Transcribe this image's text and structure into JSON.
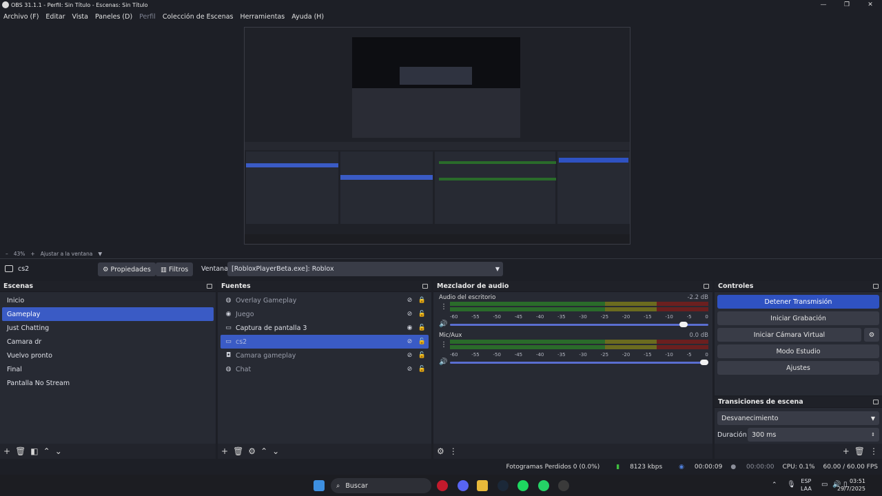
{
  "window": {
    "title": "OBS 31.1.1 - Perfil: Sin Título - Escenas: Sin Título"
  },
  "menu": [
    "Archivo (F)",
    "Editar",
    "Vista",
    "Paneles (D)",
    "Perfil",
    "Colección de Escenas",
    "Herramientas",
    "Ayuda (H)"
  ],
  "zoom": {
    "minus": "–",
    "level": "43%",
    "plus": "+",
    "fit": "Ajustar a la ventana"
  },
  "context": {
    "current": "cs2",
    "properties": "Propiedades",
    "filters": "Filtros",
    "window_label": "Ventana",
    "window_value": "[RobloxPlayerBeta.exe]: Roblox"
  },
  "scenes": {
    "title": "Escenas",
    "items": [
      "Inicio",
      "Gameplay",
      "Just Chatting",
      "Camara dr",
      "Vuelvo pronto",
      "Final",
      "Pantalla No Stream"
    ],
    "active_index": 1
  },
  "sources": {
    "title": "Fuentes",
    "items": [
      {
        "name": "Overlay Gameplay",
        "icon": "globe-icon",
        "visible": false,
        "locked": true
      },
      {
        "name": "Juego",
        "icon": "gamepad-icon",
        "visible": false,
        "locked": false
      },
      {
        "name": "Captura de pantalla 3",
        "icon": "monitor-icon",
        "visible": true,
        "locked": false
      },
      {
        "name": "cs2",
        "icon": "window-icon",
        "visible": false,
        "locked": false
      },
      {
        "name": "Camara gameplay",
        "icon": "camera-icon",
        "visible": false,
        "locked": false
      },
      {
        "name": "Chat",
        "icon": "globe-icon",
        "visible": false,
        "locked": false
      }
    ],
    "active_index": 3
  },
  "mixer": {
    "title": "Mezclador de audio",
    "ticks": [
      "-60",
      "-55",
      "-50",
      "-45",
      "-40",
      "-35",
      "-30",
      "-25",
      "-20",
      "-15",
      "-10",
      "-5",
      "0"
    ],
    "tracks": [
      {
        "name": "Audio del escritorio",
        "db": "-2.2 dB",
        "volume": 0.92
      },
      {
        "name": "Mic/Aux",
        "db": "0.0 dB",
        "volume": 1.0
      }
    ]
  },
  "controls": {
    "title": "Controles",
    "stop_stream": "Detener Transmisión",
    "start_rec": "Iniciar Grabación",
    "start_vcam": "Iniciar Cámara Virtual",
    "studio": "Modo Estudio",
    "settings": "Ajustes"
  },
  "transitions": {
    "title": "Transiciones de escena",
    "type": "Desvanecimiento",
    "duration_label": "Duración",
    "duration": "300 ms"
  },
  "status": {
    "dropped": "Fotogramas Perdidos 0 (0.0%)",
    "bitrate": "8123 kbps",
    "stream_time": "00:00:09",
    "rec_time": "00:00:00",
    "cpu": "CPU: 0.1%",
    "fps": "60.00 / 60.00 FPS"
  },
  "taskbar": {
    "search": "Buscar",
    "lang1": "ESP",
    "lang2": "LAA",
    "time": "03:51",
    "date": "29/7/2025"
  }
}
